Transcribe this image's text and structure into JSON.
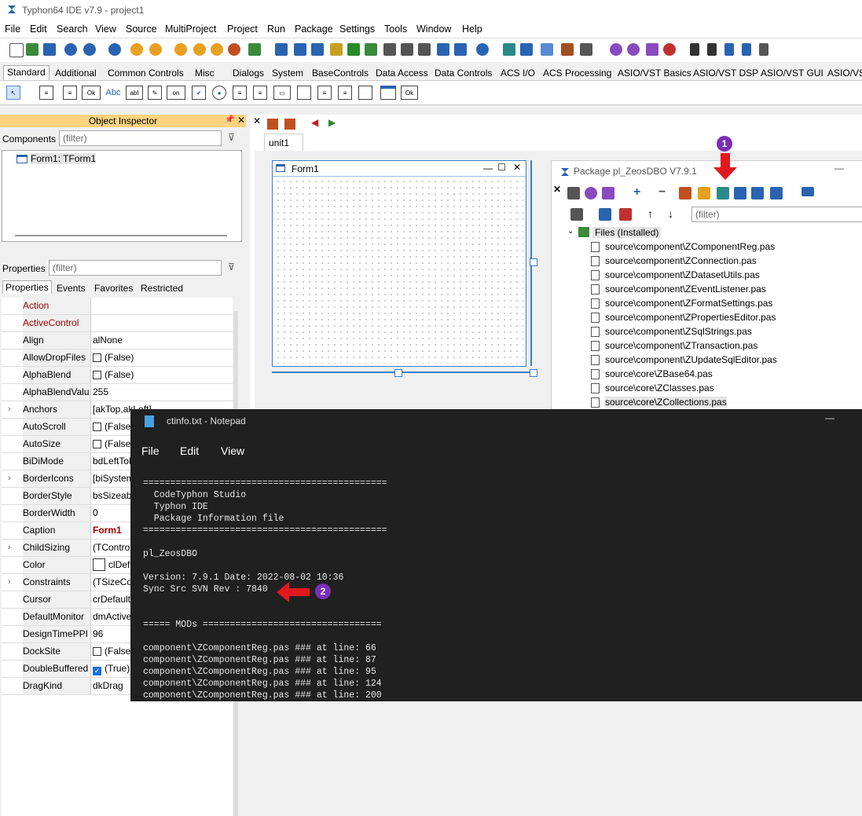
{
  "app": {
    "title": "Typhon64 IDE v7.9 - project1"
  },
  "menu": [
    "File",
    "Edit",
    "Search",
    "View",
    "Source",
    "MultiProject",
    "Project",
    "Run",
    "Package",
    "Settings",
    "Tools",
    "Window",
    "Help"
  ],
  "palette_tabs": [
    "Standard",
    "Additional",
    "Common Controls",
    "Misc",
    "Dialogs",
    "System",
    "BaseControls",
    "Data Access",
    "Data Controls",
    "ACS I/O",
    "ACS Processing",
    "ASIO/VST Basics",
    "ASIO/VST DSP",
    "ASIO/VST GUI",
    "ASIO/VS"
  ],
  "palette_items": [
    "Ok",
    "Abc",
    "abI",
    "on"
  ],
  "inspector": {
    "title": "Object Inspector",
    "components_label": "Components",
    "filter_placeholder": "(filter)",
    "tree_item": "Form1: TForm1",
    "properties_label": "Properties",
    "tabs": [
      "Properties",
      "Events",
      "Favorites",
      "Restricted"
    ],
    "rows": [
      {
        "name": "Action",
        "value": "",
        "red": true
      },
      {
        "name": "ActiveControl",
        "value": "",
        "red": true
      },
      {
        "name": "Align",
        "value": "alNone"
      },
      {
        "name": "AllowDropFiles",
        "value": "(False)",
        "cb": "off"
      },
      {
        "name": "AlphaBlend",
        "value": "(False)",
        "cb": "off"
      },
      {
        "name": "AlphaBlendValu",
        "value": "255"
      },
      {
        "name": "Anchors",
        "value": "[akTop,akLeft]",
        "exp": true
      },
      {
        "name": "AutoScroll",
        "value": "(False)",
        "cb": "off"
      },
      {
        "name": "AutoSize",
        "value": "(False)",
        "cb": "off"
      },
      {
        "name": "BiDiMode",
        "value": "bdLeftToRight"
      },
      {
        "name": "BorderIcons",
        "value": "[biSystemMenu]",
        "exp": true
      },
      {
        "name": "BorderStyle",
        "value": "bsSizeable"
      },
      {
        "name": "BorderWidth",
        "value": "0"
      },
      {
        "name": "Caption",
        "value": "Form1",
        "bold": true
      },
      {
        "name": "ChildSizing",
        "value": "(TControlChildSizing)",
        "exp": true
      },
      {
        "name": "Color",
        "value": "clDefault",
        "swatch": true
      },
      {
        "name": "Constraints",
        "value": "(TSizeConstraints)",
        "exp": true
      },
      {
        "name": "Cursor",
        "value": "crDefault"
      },
      {
        "name": "DefaultMonitor",
        "value": "dmActiveForm"
      },
      {
        "name": "DesignTimePPI",
        "value": "96"
      },
      {
        "name": "DockSite",
        "value": "(False)",
        "cb": "off"
      },
      {
        "name": "DoubleBuffered",
        "value": "(True)",
        "cb": "on"
      },
      {
        "name": "DragKind",
        "value": "dkDrag"
      }
    ]
  },
  "editor": {
    "tab": "unit1",
    "form_title": "Form1"
  },
  "package": {
    "title": "Package pl_ZeosDBO V7.9.1",
    "filter_placeholder": "(filter)",
    "group": "Files  (Installed)",
    "files": [
      "source\\component\\ZComponentReg.pas",
      "source\\component\\ZConnection.pas",
      "source\\component\\ZDatasetUtils.pas",
      "source\\component\\ZEventListener.pas",
      "source\\component\\ZFormatSettings.pas",
      "source\\component\\ZPropertiesEditor.pas",
      "source\\component\\ZSqlStrings.pas",
      "source\\component\\ZTransaction.pas",
      "source\\component\\ZUpdateSqlEditor.pas",
      "source\\core\\ZBase64.pas",
      "source\\core\\ZClasses.pas",
      "source\\core\\ZCollections.pas"
    ]
  },
  "notepad": {
    "title": "ctinfo.txt - Notepad",
    "menu": [
      "File",
      "Edit",
      "View"
    ],
    "lines": [
      "=============================================",
      "  CodeTyphon Studio",
      "  Typhon IDE",
      "  Package Information file",
      "=============================================",
      "",
      "pl_ZeosDBO",
      "",
      "Version: 7.9.1 Date: 2022-08-02 10:36",
      "Sync Src SVN Rev : 7840",
      "",
      "",
      "===== MODs =================================",
      "",
      "component\\ZComponentReg.pas ### at line: 66",
      "component\\ZComponentReg.pas ### at line: 87",
      "component\\ZComponentReg.pas ### at line: 95",
      "component\\ZComponentReg.pas ### at line: 124",
      "component\\ZComponentReg.pas ### at line: 200"
    ]
  },
  "badges": [
    "1",
    "2"
  ],
  "colors": {
    "inspector_header": "#ffd37f",
    "accent": "#1a6fd9",
    "prop_red": "#a00000",
    "arrow": "#e0191e",
    "badge": "#7a2fb8",
    "notepad_bg": "#202020"
  }
}
